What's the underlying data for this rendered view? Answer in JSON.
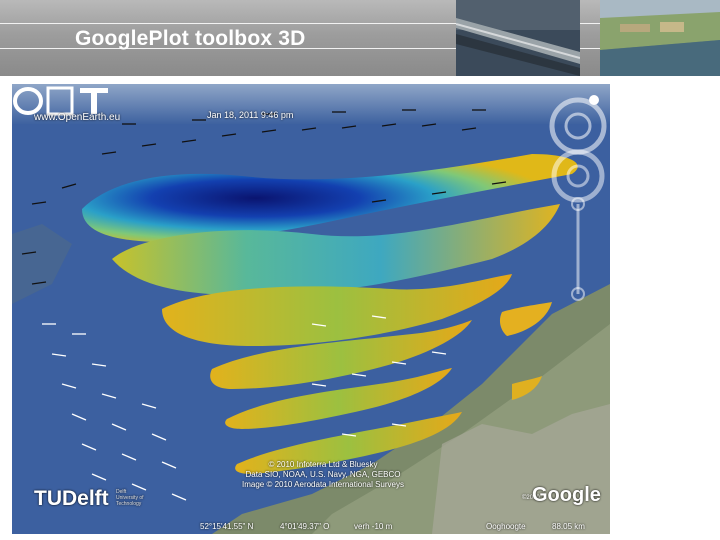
{
  "slide": {
    "title": "GooglePlot toolbox 3D"
  },
  "overlay": {
    "url_text": "www.OpenEarth.eu",
    "logo_text": "OET",
    "date_text": "Jan 18, 2011 9:46 pm"
  },
  "credits": {
    "line1": "© 2010 Infoterra Ltd & Bluesky",
    "line2": "Data SIO, NOAA, U.S. Navy, NGA, GEBCO",
    "line3": "Image © 2010 Aerodata International Surveys"
  },
  "status_bar": {
    "lat": "52°15'41.55\" N",
    "lon": "4°01'49.37\" O",
    "vert": "verh  -10 m",
    "ooghoogte_label": "Ooghoogte",
    "eye_alt": "88.05 km"
  },
  "branding": {
    "google": "Google",
    "google_small": "©2010",
    "tudelft": "TUDelft",
    "tudelft_small_1": "Delft",
    "tudelft_small_2": "University of",
    "tudelft_small_3": "Technology"
  },
  "colors": {
    "sea": "#3a5f9e",
    "header": "#9d9d9d",
    "accent_high": "#0b1f8a",
    "accent_low": "#d8a21a"
  }
}
